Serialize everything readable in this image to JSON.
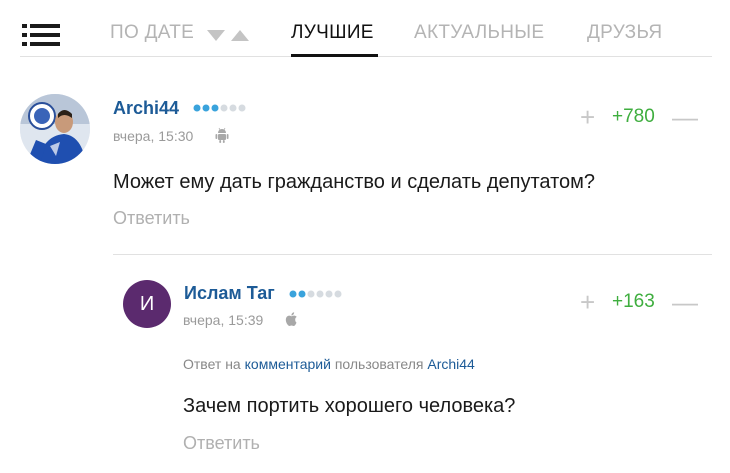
{
  "tabs": {
    "date": "ПО ДАТЕ",
    "best": "ЛУЧШИЕ",
    "actual": "АКТУАЛЬНЫЕ",
    "friends": "ДРУЗЬЯ",
    "active": "best"
  },
  "icons": {
    "menu": "menu-icon",
    "sort": "sort-arrows-icon",
    "android": "android-icon",
    "apple": "apple-icon"
  },
  "colors": {
    "username": "#1d5b97",
    "score_positive": "#3fae3f",
    "dot_active": "#3aa3dc",
    "dot_inactive": "#d6dbe0",
    "avatar_purple": "#5b2a6e"
  },
  "comments": [
    {
      "user": "Archi44",
      "rating_dots_active": 3,
      "rating_dots_total": 6,
      "time": "вчера, 15:30",
      "device": "android",
      "score": "+780",
      "text": "Может ему дать гражданство и сделать депутатом?",
      "reply_label": "Ответить"
    },
    {
      "user": "Ислам Таг",
      "avatar_letter": "И",
      "rating_dots_active": 2,
      "rating_dots_total": 6,
      "time": "вчера, 15:39",
      "device": "apple",
      "score": "+163",
      "reply_to_prefix": "Ответ на",
      "reply_to_link": "комментарий",
      "reply_to_mid": "пользователя",
      "reply_to_user": "Archi44",
      "text": "Зачем портить хорошего человека?",
      "reply_label": "Ответить"
    }
  ]
}
